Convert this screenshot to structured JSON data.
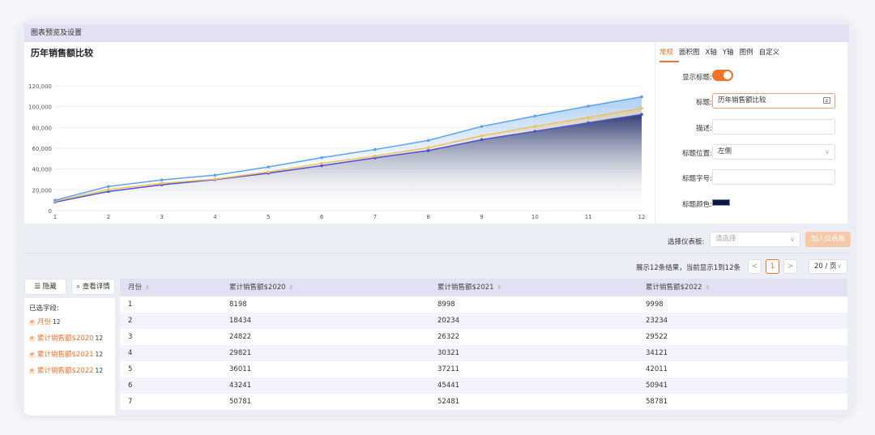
{
  "topbar": {
    "title": "图表预览及设置"
  },
  "chart_data": {
    "type": "area",
    "title": "历年销售额比较",
    "x": [
      1,
      2,
      3,
      4,
      5,
      6,
      7,
      8,
      9,
      10,
      11,
      12
    ],
    "ylim": [
      0,
      120000
    ],
    "yticks": [
      0,
      20000,
      40000,
      60000,
      80000,
      100000,
      120000
    ],
    "ytick_labels": [
      "0",
      "20,000",
      "40,000",
      "60,000",
      "80,000",
      "100,000",
      "120,000"
    ],
    "grid": true,
    "legend_position": "bottom",
    "series": [
      {
        "name": "累计销售额$2020",
        "color": "#4a4fd6",
        "values": [
          8198,
          18434,
          24822,
          29821,
          36011,
          43241,
          50781,
          57800,
          68200,
          76300,
          84500,
          92500
        ]
      },
      {
        "name": "累计销售额$2021",
        "color": "#f0c060",
        "values": [
          8998,
          20234,
          26322,
          30321,
          37211,
          45441,
          52481,
          60500,
          72000,
          81000,
          89500,
          98500
        ]
      },
      {
        "name": "累计销售额$2022",
        "color": "#5aa2f0",
        "values": [
          9998,
          23234,
          29522,
          34121,
          42011,
          50941,
          58781,
          67500,
          81000,
          91000,
          100500,
          109500
        ]
      }
    ]
  },
  "settings": {
    "tabs": [
      "常规",
      "面积图",
      "X轴",
      "Y轴",
      "图例",
      "自定义"
    ],
    "active_tab": "常规",
    "show_title_label": "显示标题:",
    "show_title_on": true,
    "title_label": "标题:",
    "title_value": "历年销售额比较",
    "desc_label": "描述:",
    "desc_value": "",
    "title_pos_label": "标题位置:",
    "title_pos_value": "左侧",
    "title_size_label": "标题字号:",
    "title_size_value": "",
    "title_color_label": "标题颜色:",
    "title_color": "#0b1a3c"
  },
  "dashboard": {
    "label": "选择仪表板:",
    "placeholder": "请选择",
    "add_button": "加入仪表板"
  },
  "pager": {
    "summary": "展示12条结果，当前显示1到12条",
    "prev": "<",
    "current_page": "1",
    "next": ">",
    "page_size": "20 / 页"
  },
  "left": {
    "hide_button": "隐藏",
    "detail_button": "查看详情",
    "fields_title": "已选字段:",
    "fields": [
      {
        "tag": "#",
        "name": "月份",
        "count": "12"
      },
      {
        "tag": "#",
        "name": "累计销售额$2020",
        "count": "12"
      },
      {
        "tag": "#",
        "name": "累计销售额$2021",
        "count": "12"
      },
      {
        "tag": "#",
        "name": "累计销售额$2022",
        "count": "12"
      }
    ]
  },
  "table": {
    "headers": [
      "月份",
      "累计销售额$2020",
      "累计销售额$2021",
      "累计销售额$2022"
    ],
    "rows": [
      [
        "1",
        "8198",
        "8998",
        "9998"
      ],
      [
        "2",
        "18434",
        "20234",
        "23234"
      ],
      [
        "3",
        "24822",
        "26322",
        "29522"
      ],
      [
        "4",
        "29821",
        "30321",
        "34121"
      ],
      [
        "5",
        "36011",
        "37211",
        "42011"
      ],
      [
        "6",
        "43241",
        "45441",
        "50941"
      ],
      [
        "7",
        "50781",
        "52481",
        "58781"
      ]
    ]
  }
}
